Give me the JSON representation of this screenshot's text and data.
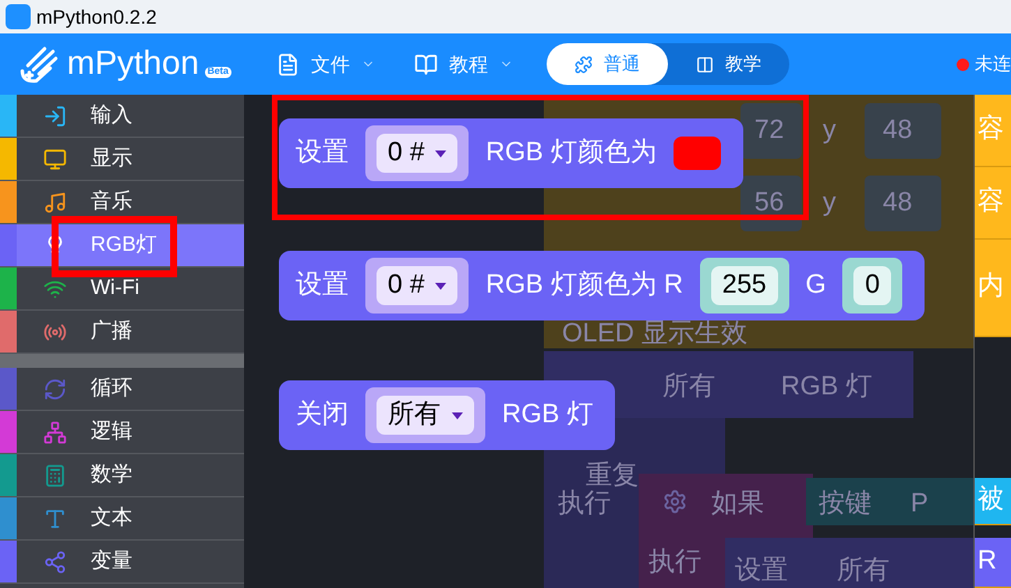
{
  "title_bar": {
    "title": "mPython0.2.2"
  },
  "header": {
    "logo": "mPython",
    "badge": "Beta",
    "menus": [
      {
        "label": "文件",
        "kind": "file"
      },
      {
        "label": "教程",
        "kind": "tutorial"
      }
    ],
    "modes": [
      {
        "label": "普通",
        "kind": "blocks",
        "selected": true
      },
      {
        "label": "教学",
        "kind": "teach",
        "selected": false
      }
    ],
    "status": {
      "label": "未连",
      "connected": false
    }
  },
  "sidebar": {
    "groups": [
      [
        {
          "label": "输入",
          "kind": "input",
          "color": "#29b6f6",
          "selected": false
        },
        {
          "label": "显示",
          "kind": "display",
          "color": "#f5b800",
          "selected": false
        },
        {
          "label": "音乐",
          "kind": "music",
          "color": "#f7941d",
          "selected": false
        },
        {
          "label": "RGB灯",
          "kind": "rgb",
          "color": "#6b63f5",
          "selected": true
        },
        {
          "label": "Wi-Fi",
          "kind": "wifi",
          "color": "#1db34a",
          "selected": false
        },
        {
          "label": "广播",
          "kind": "radio",
          "color": "#e06b6b",
          "selected": false
        }
      ],
      [
        {
          "label": "循环",
          "kind": "loop",
          "color": "#5b58c9",
          "selected": false
        },
        {
          "label": "逻辑",
          "kind": "logic",
          "color": "#d33ad6",
          "selected": false
        },
        {
          "label": "数学",
          "kind": "math",
          "color": "#139a8f",
          "selected": false
        },
        {
          "label": "文本",
          "kind": "text",
          "color": "#2f8fcf",
          "selected": false
        },
        {
          "label": "变量",
          "kind": "variable",
          "color": "#6b63f5",
          "selected": false
        }
      ]
    ]
  },
  "flyout": {
    "blocks": [
      {
        "parts": [
          {
            "kind": "text",
            "text": "设置"
          },
          {
            "kind": "dropdown",
            "text": "0 #"
          },
          {
            "kind": "text",
            "text": "RGB 灯颜色为"
          },
          {
            "kind": "color",
            "color": "#ff0000"
          }
        ]
      },
      {
        "parts": [
          {
            "kind": "text",
            "text": "设置"
          },
          {
            "kind": "dropdown",
            "text": "0 #"
          },
          {
            "kind": "text",
            "text": "RGB 灯颜色为 R"
          },
          {
            "kind": "number",
            "text": "255"
          },
          {
            "kind": "text",
            "text": "G"
          },
          {
            "kind": "number",
            "text": "0"
          }
        ]
      },
      {
        "parts": [
          {
            "kind": "text",
            "text": "关闭"
          },
          {
            "kind": "dropdown",
            "text": "所有"
          },
          {
            "kind": "text",
            "text": "RGB 灯"
          }
        ]
      }
    ]
  },
  "workspace": {
    "faded_texts": [
      "72",
      "y",
      "48",
      "56",
      "y",
      "48",
      "OLED 显示生效",
      "所有",
      "RGB 灯",
      "重复",
      "执行",
      "如果",
      "按键",
      "P",
      "执行",
      "设置",
      "所有"
    ],
    "edge_texts": [
      "容",
      "容",
      "内",
      "被",
      "R"
    ]
  }
}
